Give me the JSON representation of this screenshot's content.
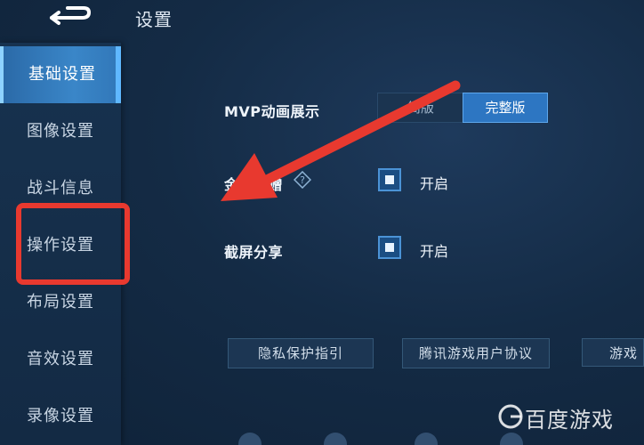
{
  "header": {
    "title": "设置"
  },
  "sidebar": {
    "items": [
      {
        "label": "基础设置"
      },
      {
        "label": "图像设置"
      },
      {
        "label": "战斗信息"
      },
      {
        "label": "操作设置"
      },
      {
        "label": "布局设置"
      },
      {
        "label": "音效设置"
      },
      {
        "label": "录像设置"
      }
    ],
    "active_index": 0,
    "highlighted_index": 3
  },
  "settings": {
    "mvp": {
      "label": "MVP动画展示",
      "options": [
        "简版",
        "完整版"
      ],
      "selected": "完整版"
    },
    "gift": {
      "label": "金…回赠",
      "value": "开启",
      "checked": true
    },
    "screenshot": {
      "label": "截屏分享",
      "value": "开启",
      "checked": true
    }
  },
  "bottom_buttons": [
    {
      "label": "隐私保护指引"
    },
    {
      "label": "腾讯游戏用户协议"
    },
    {
      "label": "游戏"
    }
  ],
  "watermark": {
    "text": "百度游戏"
  },
  "colors": {
    "accent": "#2d76c2",
    "annotation": "#e8392f",
    "background": "#142b45"
  },
  "icons": {
    "back": "back-arrow-icon",
    "help": "question-diamond-icon",
    "watermark": "baidu-games-logo-icon"
  }
}
